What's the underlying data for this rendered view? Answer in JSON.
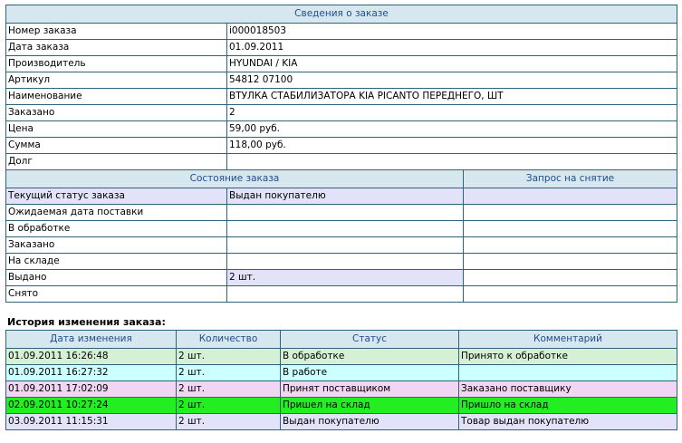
{
  "order_info": {
    "header": "Сведения о заказе",
    "rows": [
      {
        "label": "Номер заказа",
        "value": "i000018503"
      },
      {
        "label": "Дата заказа",
        "value": "01.09.2011"
      },
      {
        "label": "Производитель",
        "value": "HYUNDAI / KIA"
      },
      {
        "label": "Артикул",
        "value": "54812 07100"
      },
      {
        "label": "Наименование",
        "value": "ВТУЛКА СТАБИЛИЗАТОРА KIA PICANTO ПЕРЕДНЕГО, ШТ"
      },
      {
        "label": "Заказано",
        "value": "2"
      },
      {
        "label": "Цена",
        "value": "59,00 руб."
      },
      {
        "label": "Сумма",
        "value": "118,00 руб."
      },
      {
        "label": "Долг",
        "value": ""
      }
    ]
  },
  "order_state": {
    "header": "Состояние заказа",
    "request_header": "Запрос на снятие",
    "rows": [
      {
        "label": "Текущий статус заказа",
        "value": "Выдан покупателю"
      },
      {
        "label": "Ожидаемая дата поставки",
        "value": ""
      },
      {
        "label": "В обработке",
        "value": ""
      },
      {
        "label": "Заказано",
        "value": ""
      },
      {
        "label": "На складе",
        "value": ""
      },
      {
        "label": "Выдано",
        "value": "2 шт."
      },
      {
        "label": "Снято",
        "value": ""
      }
    ]
  },
  "history": {
    "title": "История изменения заказа:",
    "columns": [
      "Дата изменения",
      "Количество",
      "Статус",
      "Комментарий"
    ],
    "rows": [
      [
        "01.09.2011 16:26:48",
        "2 шт.",
        "В обработке",
        "Принято к обработке"
      ],
      [
        "01.09.2011 16:27:32",
        "2 шт.",
        "В работе",
        ""
      ],
      [
        "01.09.2011 17:02:09",
        "2 шт.",
        "Принят поставщиком",
        "Заказано поставщику"
      ],
      [
        "02.09.2011 10:27:24",
        "2 шт.",
        "Пришел на склад",
        "Пришло на склад"
      ],
      [
        "03.09.2011 11:15:31",
        "2 шт.",
        "Выдан покупателю",
        "Товар выдан покупателю"
      ]
    ],
    "row_colors": [
      "#d5f0d5",
      "#ccffff",
      "#f2d5f2",
      "#22ee22",
      "#e2e3f9"
    ]
  },
  "colors": {
    "header_bg": "#d7e7f0",
    "header_text": "#1f4e8a",
    "border": "#2f6378",
    "highlight": "#e2e3f9"
  }
}
